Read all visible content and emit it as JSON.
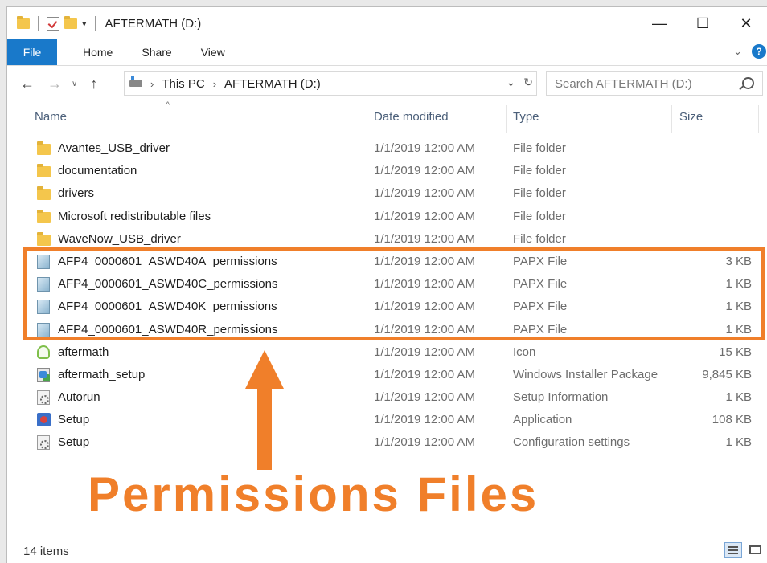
{
  "window": {
    "title": "AFTERMATH (D:)",
    "controls": {
      "minimize": "—",
      "maximize": "☐",
      "close": "✕"
    }
  },
  "ribbon": {
    "tabs": [
      "File",
      "Home",
      "Share",
      "View"
    ]
  },
  "nav": {
    "breadcrumb": [
      "This PC",
      "AFTERMATH (D:)"
    ],
    "search_placeholder": "Search AFTERMATH (D:)"
  },
  "columns": {
    "name": "Name",
    "date": "Date modified",
    "type": "Type",
    "size": "Size"
  },
  "files": [
    {
      "icon": "folder-icon",
      "name": "Avantes_USB_driver",
      "date": "1/1/2019 12:00 AM",
      "type": "File folder",
      "size": ""
    },
    {
      "icon": "folder-icon",
      "name": "documentation",
      "date": "1/1/2019 12:00 AM",
      "type": "File folder",
      "size": ""
    },
    {
      "icon": "folder-icon",
      "name": "drivers",
      "date": "1/1/2019 12:00 AM",
      "type": "File folder",
      "size": ""
    },
    {
      "icon": "folder-icon",
      "name": "Microsoft redistributable files",
      "date": "1/1/2019 12:00 AM",
      "type": "File folder",
      "size": ""
    },
    {
      "icon": "folder-icon",
      "name": "WaveNow_USB_driver",
      "date": "1/1/2019 12:00 AM",
      "type": "File folder",
      "size": ""
    },
    {
      "icon": "papx-file-icon",
      "name": "AFP4_0000601_ASWD40A_permissions",
      "date": "1/1/2019 12:00 AM",
      "type": "PAPX File",
      "size": "3 KB"
    },
    {
      "icon": "papx-file-icon",
      "name": "AFP4_0000601_ASWD40C_permissions",
      "date": "1/1/2019 12:00 AM",
      "type": "PAPX File",
      "size": "1 KB"
    },
    {
      "icon": "papx-file-icon",
      "name": "AFP4_0000601_ASWD40K_permissions",
      "date": "1/1/2019 12:00 AM",
      "type": "PAPX File",
      "size": "1 KB"
    },
    {
      "icon": "papx-file-icon",
      "name": "AFP4_0000601_ASWD40R_permissions",
      "date": "1/1/2019 12:00 AM",
      "type": "PAPX File",
      "size": "1 KB"
    },
    {
      "icon": "aftermath-icon",
      "name": "aftermath",
      "date": "1/1/2019 12:00 AM",
      "type": "Icon",
      "size": "15 KB"
    },
    {
      "icon": "installer-icon",
      "name": "aftermath_setup",
      "date": "1/1/2019 12:00 AM",
      "type": "Windows Installer Package",
      "size": "9,845 KB"
    },
    {
      "icon": "setup-info-icon",
      "name": "Autorun",
      "date": "1/1/2019 12:00 AM",
      "type": "Setup Information",
      "size": "1 KB"
    },
    {
      "icon": "application-icon",
      "name": "Setup",
      "date": "1/1/2019 12:00 AM",
      "type": "Application",
      "size": "108 KB"
    },
    {
      "icon": "config-settings-icon",
      "name": "Setup",
      "date": "1/1/2019 12:00 AM",
      "type": "Configuration settings",
      "size": "1 KB"
    }
  ],
  "annotation": {
    "label": "Permissions Files",
    "color": "#f07f2a"
  },
  "status": {
    "count": "14 items"
  },
  "colors": {
    "accent": "#1979ca",
    "annotation": "#f07f2a"
  }
}
